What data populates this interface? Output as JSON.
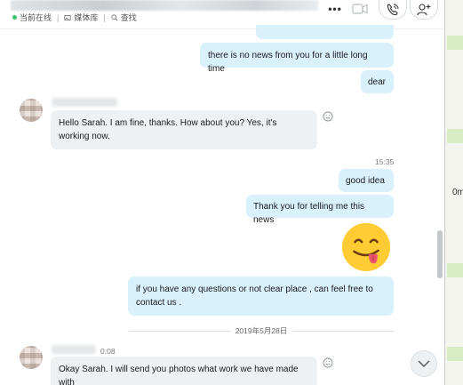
{
  "header": {
    "status_online": "当前在线",
    "media_label": "媒体库",
    "search_label": "查找",
    "more_label": "•••"
  },
  "messages": {
    "out1": "there is no news from you for a little long time",
    "out2": "dear",
    "in1": "Hello Sarah. I am fine, thanks. How about you? Yes, it's working now.",
    "time1": "15:35",
    "out3": "good idea",
    "out4": "Thank you for telling me this news",
    "out5": "if you have any questions or not clear place , can feel free to contact us .",
    "date_divider": "2019年5月28日",
    "time2": "0:08",
    "in2": "Okay Sarah. I will send you photos what work we have made with"
  },
  "right_edge": {
    "fragment": "0m"
  },
  "colors": {
    "outgoing_bubble": "#d9f1fc",
    "incoming_bubble": "#eef1f4",
    "online": "#3cc46a",
    "emoji_face": "#ffcc33"
  },
  "icons": {
    "more": "more-icon",
    "video": "video-camera-icon",
    "call": "phone-call-icon",
    "add_contact": "add-person-icon",
    "react": "smiley-react-icon",
    "scroll_down": "chevron-down-icon",
    "emoji": "tongue-out-emoji"
  }
}
